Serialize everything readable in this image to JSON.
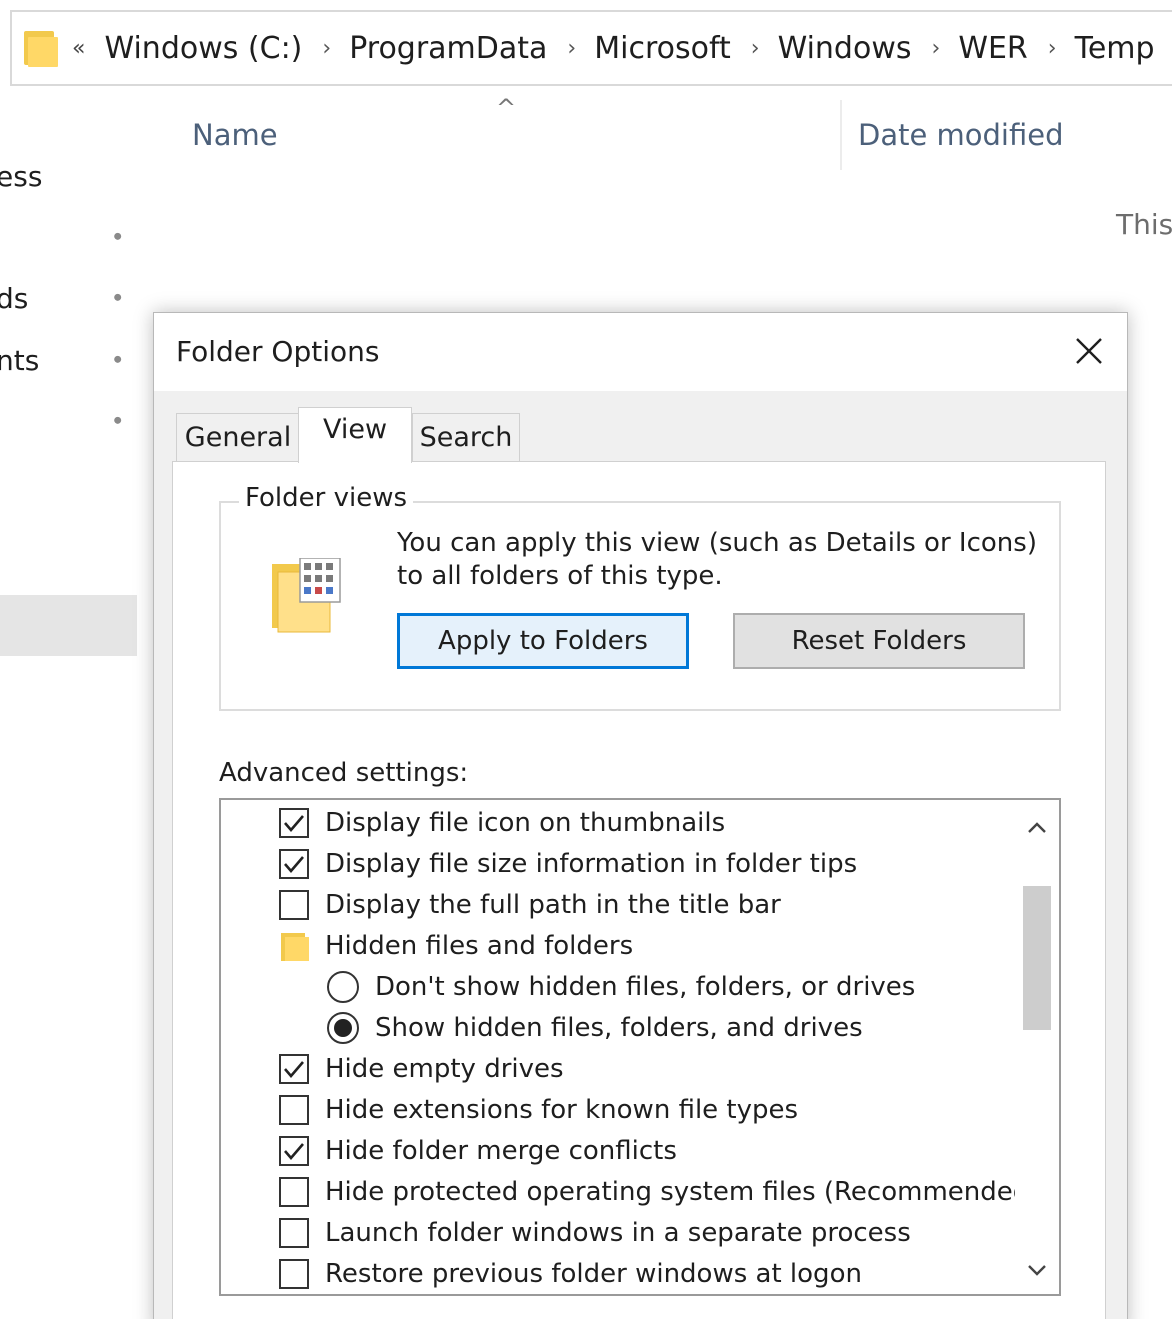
{
  "explorer": {
    "address": {
      "overflow": "«",
      "crumbs": [
        "Windows (C:)",
        "ProgramData",
        "Microsoft",
        "Windows",
        "WER",
        "Temp"
      ],
      "separator": "›"
    },
    "nav": {
      "items": [
        "ess",
        "ds",
        "nts"
      ],
      "pin_glyph": "📌"
    },
    "columns": {
      "name": "Name",
      "date_modified": "Date modified",
      "sort_indicator": "^"
    },
    "empty_message": "This"
  },
  "dialog": {
    "title": "Folder Options",
    "close_icon": "close-icon",
    "tabs": [
      {
        "label": "General",
        "active": false
      },
      {
        "label": "View",
        "active": true
      },
      {
        "label": "Search",
        "active": false
      }
    ],
    "folder_views": {
      "group_label": "Folder views",
      "description": "You can apply this view (such as Details or Icons) to all folders of this type.",
      "apply_button": "Apply to Folders",
      "reset_button": "Reset Folders"
    },
    "advanced": {
      "label": "Advanced settings:",
      "items": [
        {
          "type": "checkbox",
          "label": "Display file icon on thumbnails",
          "checked": true,
          "indent": 0
        },
        {
          "type": "checkbox",
          "label": "Display file size information in folder tips",
          "checked": true,
          "indent": 0
        },
        {
          "type": "checkbox",
          "label": "Display the full path in the title bar",
          "checked": false,
          "indent": 0
        },
        {
          "type": "folder",
          "label": "Hidden files and folders",
          "indent": 0
        },
        {
          "type": "radio",
          "label": "Don't show hidden files, folders, or drives",
          "checked": false,
          "indent": 1
        },
        {
          "type": "radio",
          "label": "Show hidden files, folders, and drives",
          "checked": true,
          "indent": 1
        },
        {
          "type": "checkbox",
          "label": "Hide empty drives",
          "checked": true,
          "indent": 0
        },
        {
          "type": "checkbox",
          "label": "Hide extensions for known file types",
          "checked": false,
          "indent": 0
        },
        {
          "type": "checkbox",
          "label": "Hide folder merge conflicts",
          "checked": true,
          "indent": 0
        },
        {
          "type": "checkbox",
          "label": "Hide protected operating system files (Recommended)",
          "checked": false,
          "indent": 0
        },
        {
          "type": "checkbox",
          "label": "Launch folder windows in a separate process",
          "checked": false,
          "indent": 0
        },
        {
          "type": "checkbox",
          "label": "Restore previous folder windows at logon",
          "checked": false,
          "indent": 0
        }
      ]
    }
  },
  "colors": {
    "accent": "#0078d7",
    "folder_back": "#f2c94c",
    "folder_front": "#ffd867",
    "header_text": "#4c607a"
  }
}
